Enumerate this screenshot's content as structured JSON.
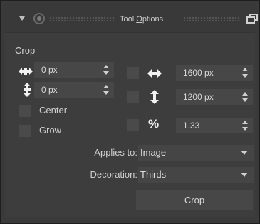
{
  "panel": {
    "title": "Tool Options",
    "title_mnemonic": "O"
  },
  "crop": {
    "section_label": "Crop",
    "x_offset": "0 px",
    "y_offset": "0 px",
    "center_label": "Center",
    "grow_label": "Grow",
    "width": "1600 px",
    "height": "1200 px",
    "ratio_symbol": "%",
    "ratio": "1.33",
    "applies_to_label": "Applies to:",
    "applies_to_value": "Image",
    "decoration_label": "Decoration:",
    "decoration_value": "Thirds",
    "crop_button": "Crop"
  },
  "colors": {
    "panel_bg": "#3a3a3a",
    "field_bg": "#474747",
    "text": "#d4d4d4"
  },
  "icons": [
    "collapse-arrow-icon",
    "pin-icon",
    "float-window-icon",
    "horizontal-move-icon",
    "vertical-move-icon",
    "width-arrows-icon",
    "height-arrows-icon",
    "spinner-arrows-icon",
    "dropdown-caret-icon"
  ]
}
